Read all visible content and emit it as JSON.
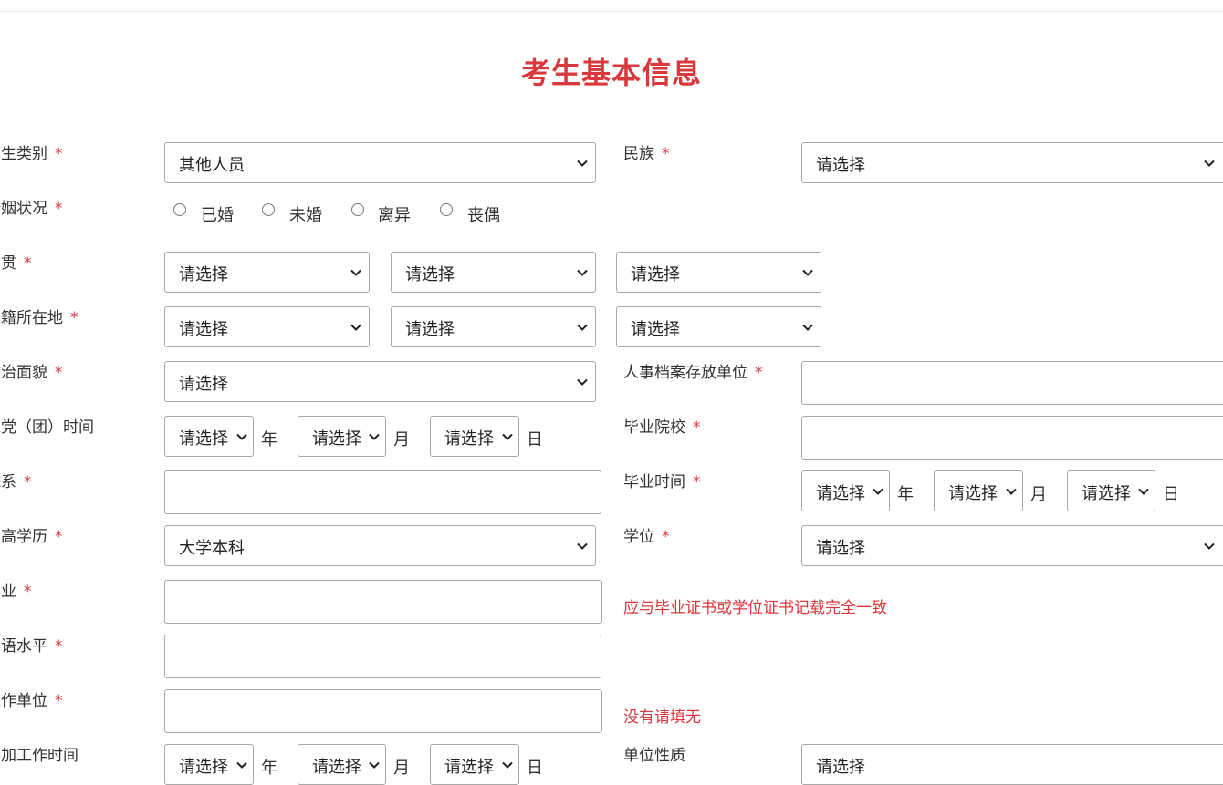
{
  "page_title": "考生基本信息",
  "placeholder": "请选择",
  "placeholder_cut": "请选择",
  "units": {
    "year": "年",
    "month": "月",
    "day": "日"
  },
  "fields": {
    "category": {
      "label": "考生类别",
      "value": "其他人员"
    },
    "ethnicity": {
      "label": "民族",
      "value": "请选择"
    },
    "marital": {
      "label": "婚姻状况",
      "options": [
        "已婚",
        "未婚",
        "离异",
        "丧偶"
      ]
    },
    "native_place": {
      "label": "籍贯"
    },
    "household": {
      "label": "户籍所在地"
    },
    "political": {
      "label": "政治面貌",
      "value": "请选择"
    },
    "archive_unit": {
      "label": "人事档案存放单位",
      "value": ""
    },
    "party_date": {
      "label": "入党（团）时间"
    },
    "school": {
      "label": "毕业院校",
      "value": ""
    },
    "department": {
      "label": "院系",
      "value": ""
    },
    "grad_date": {
      "label": "毕业时间"
    },
    "education": {
      "label": "最高学历",
      "value": "大学本科"
    },
    "degree": {
      "label": "学位",
      "value": "请选择"
    },
    "major": {
      "label": "专业",
      "value": "",
      "hint": "应与毕业证书或学位证书记载完全一致"
    },
    "language": {
      "label": "外语水平",
      "value": ""
    },
    "employer": {
      "label": "工作单位",
      "value": "",
      "hint": "没有请填无"
    },
    "work_start": {
      "label": "参加工作时间"
    },
    "unit_nature": {
      "label": "单位性质",
      "value": "请选择"
    }
  },
  "colors": {
    "accent": "#d9383d",
    "border": "#a8a8a8"
  }
}
